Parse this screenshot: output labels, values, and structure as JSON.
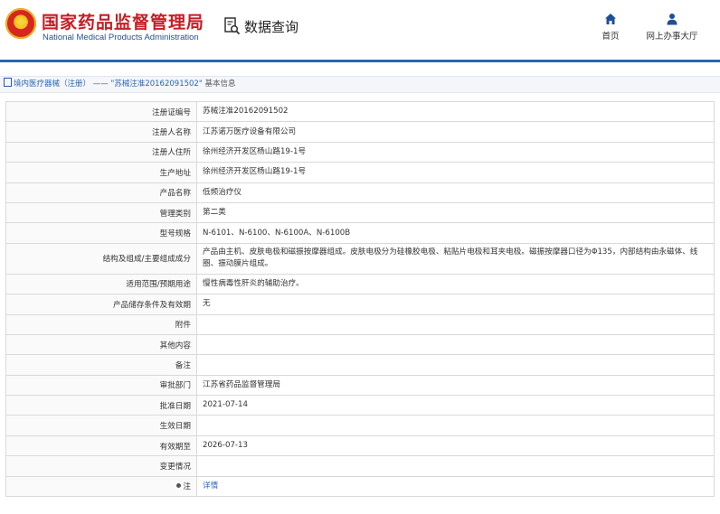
{
  "header": {
    "brand_cn": "国家药品监督管理局",
    "brand_en": "National Medical Products Administration",
    "page_title": "数据查询",
    "nav": [
      {
        "label": "首页",
        "icon": "home-icon"
      },
      {
        "label": "网上办事大厅",
        "icon": "user-icon"
      }
    ]
  },
  "breadcrumb": {
    "part1": "境内医疗器械（注册）",
    "arrow": "——",
    "part2": "\"苏械注准20162091502\"",
    "part3": "基本信息"
  },
  "rows": [
    {
      "label": "注册证编号",
      "value": "苏械注准20162091502"
    },
    {
      "label": "注册人名称",
      "value": "江苏诺万医疗设备有限公司"
    },
    {
      "label": "注册人住所",
      "value": "徐州经济开发区杨山路19-1号"
    },
    {
      "label": "生产地址",
      "value": "徐州经济开发区杨山路19-1号"
    },
    {
      "label": "产品名称",
      "value": "低频治疗仪"
    },
    {
      "label": "管理类别",
      "value": "第二类"
    },
    {
      "label": "型号规格",
      "value": "N-6101、N-6100、N-6100A、N-6100B"
    },
    {
      "label": "结构及组成/主要组成成分",
      "value": "产品由主机、皮肤电极和磁振按摩器组成。皮肤电极分为硅橡胶电极、粘贴片电极和耳夹电极。磁振按摩器口径为Φ135，内部结构由永磁体、线圈、振动膜片组成。"
    },
    {
      "label": "适用范围/预期用途",
      "value": "慢性病毒性肝炎的辅助治疗。"
    },
    {
      "label": "产品储存条件及有效期",
      "value": "无"
    },
    {
      "label": "附件",
      "value": ""
    },
    {
      "label": "其他内容",
      "value": ""
    },
    {
      "label": "备注",
      "value": ""
    },
    {
      "label": "审批部门",
      "value": "江苏省药品监督管理局"
    },
    {
      "label": "批准日期",
      "value": "2021-07-14"
    },
    {
      "label": "生效日期",
      "value": ""
    },
    {
      "label": "有效期至",
      "value": "2026-07-13"
    },
    {
      "label": "变更情况",
      "value": ""
    }
  ],
  "note_row": {
    "label": "注",
    "link_text": "详情"
  },
  "colors": {
    "brand_red": "#c51d23",
    "brand_blue": "#2b66b1"
  }
}
